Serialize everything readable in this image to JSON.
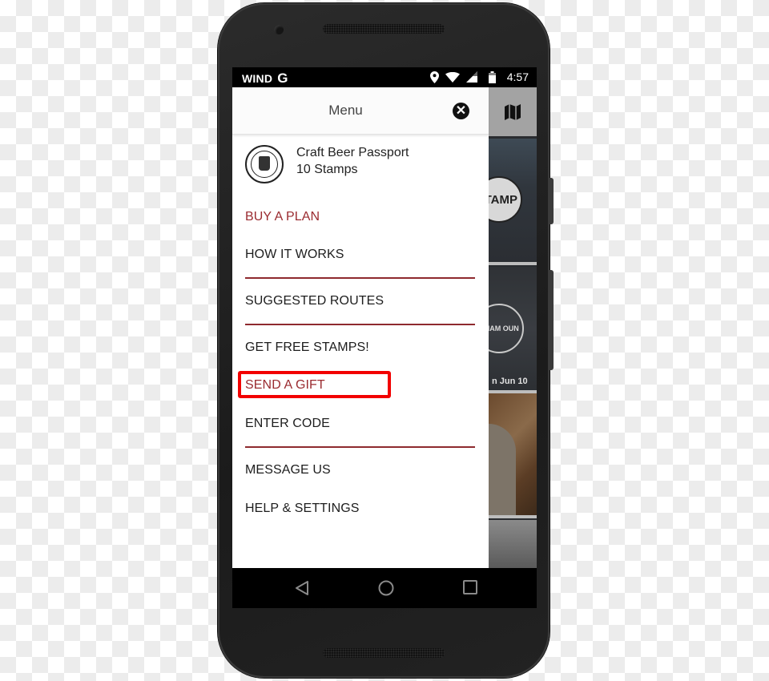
{
  "status_bar": {
    "carrier": "WIND",
    "carrier_suffix": "G",
    "time": "4:57",
    "icons": [
      "location-icon",
      "wifi-icon",
      "signal-icon",
      "battery-icon"
    ]
  },
  "drawer": {
    "title": "Menu",
    "close_icon": "close-icon",
    "profile": {
      "name": "Craft Beer Passport",
      "stamps": "10 Stamps",
      "logo_icon": "craft-beer-passport-logo"
    },
    "items": [
      {
        "label": "BUY A PLAN",
        "accent": true
      },
      {
        "label": "HOW IT WORKS",
        "accent": false
      },
      {
        "label": "SUGGESTED ROUTES",
        "accent": false
      },
      {
        "label": "GET FREE STAMPS!",
        "accent": false
      },
      {
        "label": "SEND A GIFT",
        "accent": true,
        "highlighted": true
      },
      {
        "label": "ENTER CODE",
        "accent": false
      },
      {
        "label": "MESSAGE US",
        "accent": false
      },
      {
        "label": "HELP & SETTINGS",
        "accent": false
      }
    ]
  },
  "background_app": {
    "map_icon": "map-icon",
    "stamp_button": "TAMP",
    "badge_text": "RHAM OUN",
    "date_text": "n Jun 10"
  },
  "nav_bar": {
    "buttons": [
      "back-icon",
      "home-icon",
      "recents-icon"
    ]
  },
  "colors": {
    "accent": "#9a2b30",
    "highlight": "#f20000",
    "divider": "#8e2a2e"
  }
}
